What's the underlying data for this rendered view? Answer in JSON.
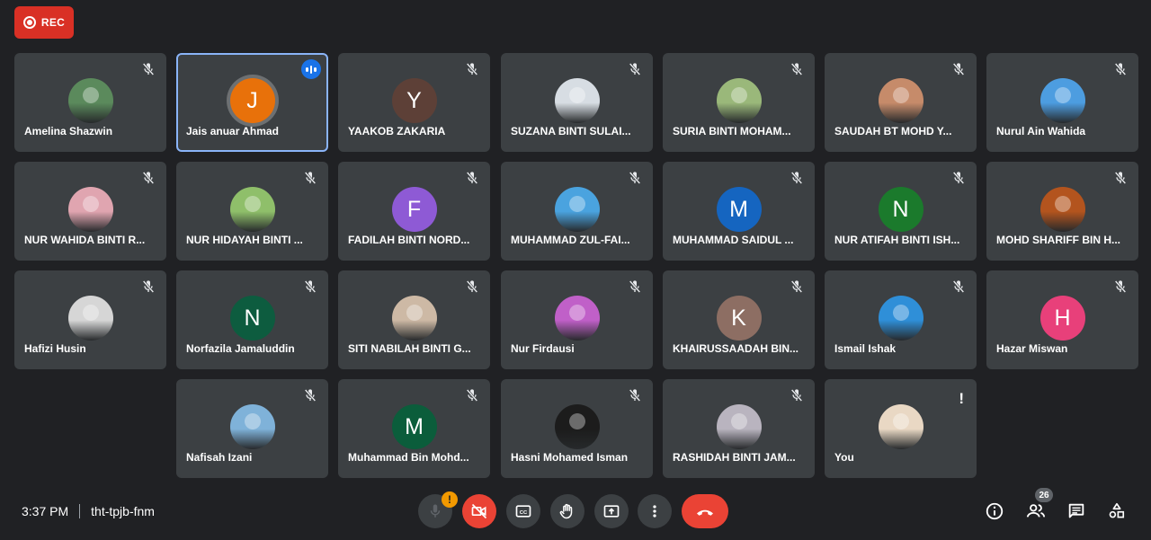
{
  "recording": {
    "label": "REC"
  },
  "participants": [
    {
      "name": "Amelina Shazwin",
      "initial": "",
      "color": "#5b8a5c",
      "kind": "photo"
    },
    {
      "name": "Jais anuar Ahmad",
      "initial": "J",
      "color": "#e8710a",
      "kind": "initial",
      "speaking": true
    },
    {
      "name": "YAAKOB ZAKARIA",
      "initial": "Y",
      "color": "#5d4037",
      "kind": "initial"
    },
    {
      "name": "SUZANA BINTI SULAI...",
      "initial": "",
      "color": "#d7dde3",
      "kind": "photo"
    },
    {
      "name": "SURIA BINTI MOHAM...",
      "initial": "",
      "color": "#9ab87a",
      "kind": "photo"
    },
    {
      "name": "SAUDAH BT MOHD Y...",
      "initial": "",
      "color": "#c68b6a",
      "kind": "photo"
    },
    {
      "name": "Nurul Ain Wahida",
      "initial": "",
      "color": "#4d9de0",
      "kind": "photo"
    },
    {
      "name": "NUR WAHIDA BINTI R...",
      "initial": "",
      "color": "#e0a5b0",
      "kind": "photo"
    },
    {
      "name": "NUR HIDAYAH BINTI ...",
      "initial": "",
      "color": "#8fbf6a",
      "kind": "photo"
    },
    {
      "name": "FADILAH BINTI NORD...",
      "initial": "F",
      "color": "#8e5ad5",
      "kind": "initial"
    },
    {
      "name": "MUHAMMAD ZUL-FAI...",
      "initial": "",
      "color": "#4aa3df",
      "kind": "photo"
    },
    {
      "name": "MUHAMMAD SAIDUL ...",
      "initial": "M",
      "color": "#1565c0",
      "kind": "initial"
    },
    {
      "name": "NUR ATIFAH BINTI ISH...",
      "initial": "N",
      "color": "#1b7a2c",
      "kind": "initial"
    },
    {
      "name": "MOHD SHARIFF BIN H...",
      "initial": "",
      "color": "#b3541e",
      "kind": "photo"
    },
    {
      "name": "Hafizi Husin",
      "initial": "",
      "color": "#d6d6d6",
      "kind": "photo"
    },
    {
      "name": "Norfazila Jamaluddin",
      "initial": "N",
      "color": "#0d5c3f",
      "kind": "initial"
    },
    {
      "name": "SITI NABILAH BINTI G...",
      "initial": "",
      "color": "#cdb9a5",
      "kind": "photo"
    },
    {
      "name": "Nur Firdausi",
      "initial": "",
      "color": "#c060c8",
      "kind": "photo"
    },
    {
      "name": "KHAIRUSSAADAH BIN...",
      "initial": "K",
      "color": "#8d6e63",
      "kind": "initial"
    },
    {
      "name": "Ismail Ishak",
      "initial": "",
      "color": "#2f8fd8",
      "kind": "photo"
    },
    {
      "name": "Hazar Miswan",
      "initial": "H",
      "color": "#e8407a",
      "kind": "initial"
    },
    {
      "name": "Nafisah Izani",
      "initial": "",
      "color": "#7fb2d9",
      "kind": "photo"
    },
    {
      "name": "Muhammad Bin Mohd...",
      "initial": "M",
      "color": "#0b5d3b",
      "kind": "initial"
    },
    {
      "name": "Hasni Mohamed Isman",
      "initial": "",
      "color": "#1c1c1c",
      "kind": "photo"
    },
    {
      "name": "RASHIDAH BINTI JAM...",
      "initial": "",
      "color": "#b9b4bf",
      "kind": "photo"
    },
    {
      "name": "You",
      "initial": "",
      "color": "#e9d8c4",
      "kind": "photo",
      "alert": "!"
    }
  ],
  "meeting": {
    "time": "3:37 PM",
    "code": "tht-tpjb-fnm"
  },
  "controls": {
    "mic_warning": "!",
    "icons": [
      "mic-icon",
      "camera-off-icon",
      "captions-icon",
      "raise-hand-icon",
      "present-icon",
      "more-options-icon",
      "end-call-icon"
    ]
  },
  "right_panel": {
    "participant_count": "26"
  }
}
